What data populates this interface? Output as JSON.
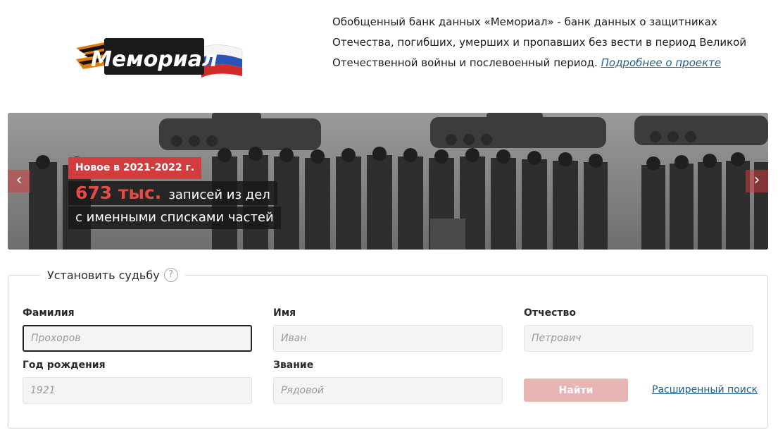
{
  "header": {
    "logo_text": "Мемориал",
    "intro_text": "Обобщенный банк данных «Мемориал» - банк данных о защитниках Отечества, погибших, умерших и пропавших без вести в период Великой Отечественной войны и послевоенный период.",
    "more_link": "Подробнее о проекте"
  },
  "banner": {
    "badge": "Новое в 2021-2022 г.",
    "count": "673 тыс.",
    "line1_rest": "записей из дел",
    "line2": "с именными списками частей",
    "prev_arrow": "‹",
    "next_arrow": "›"
  },
  "search": {
    "legend": "Установить судьбу",
    "help": "?",
    "fields": {
      "surname": {
        "label": "Фамилия",
        "placeholder": "Прохоров",
        "value": ""
      },
      "name": {
        "label": "Имя",
        "placeholder": "Иван",
        "value": ""
      },
      "patronymic": {
        "label": "Отчество",
        "placeholder": "Петрович",
        "value": ""
      },
      "birth_year": {
        "label": "Год рождения",
        "placeholder": "1921",
        "value": ""
      },
      "rank": {
        "label": "Звание",
        "placeholder": "Рядовой",
        "value": ""
      }
    },
    "submit": "Найти",
    "advanced": "Расширенный поиск"
  },
  "colors": {
    "accent": "#d23c3c",
    "link": "#1e5f8c",
    "button_disabled": "#e8b4b4"
  }
}
